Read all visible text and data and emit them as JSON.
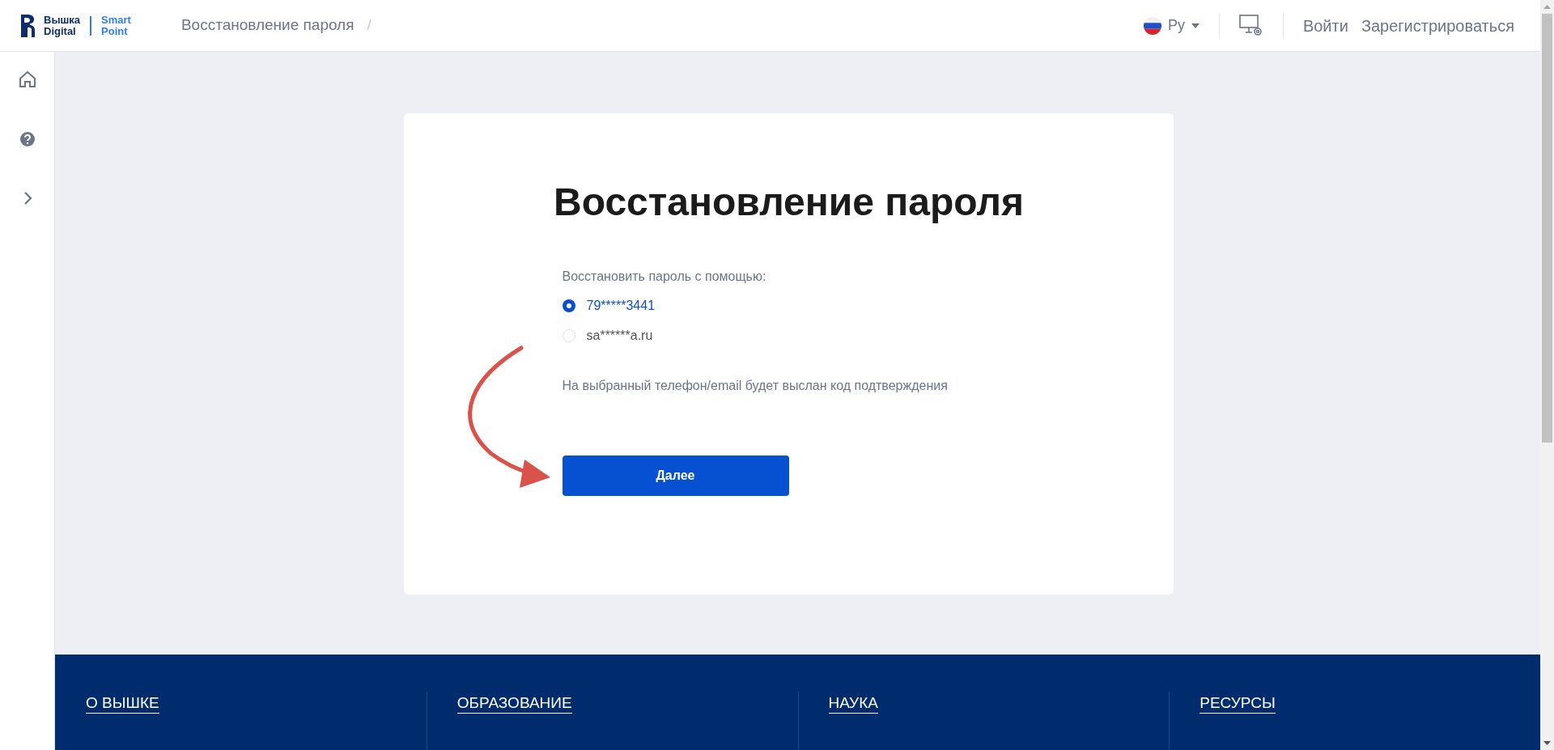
{
  "header": {
    "logo": {
      "line_1": "Вышка",
      "line_2": "Digital",
      "sub_line_1": "Smart",
      "sub_line_2": "Point"
    },
    "breadcrumb": "Восстановление пароля",
    "breadcrumb_separator": "/",
    "language": "Ру",
    "login": "Войти",
    "register": "Зарегистрироваться"
  },
  "card": {
    "title": "Восстановление пароля",
    "prompt": "Восстановить пароль с помощью:",
    "options": [
      {
        "label": "79*****3441",
        "selected": true
      },
      {
        "label": "sa******a.ru",
        "selected": false
      }
    ],
    "info": "На выбранный телефон/email будет выслан код подтверждения",
    "button": "Далее"
  },
  "footer": {
    "sections": [
      "О ВЫШКЕ",
      "ОБРАЗОВАНИЕ",
      "НАУКА",
      "РЕСУРСЫ"
    ]
  }
}
